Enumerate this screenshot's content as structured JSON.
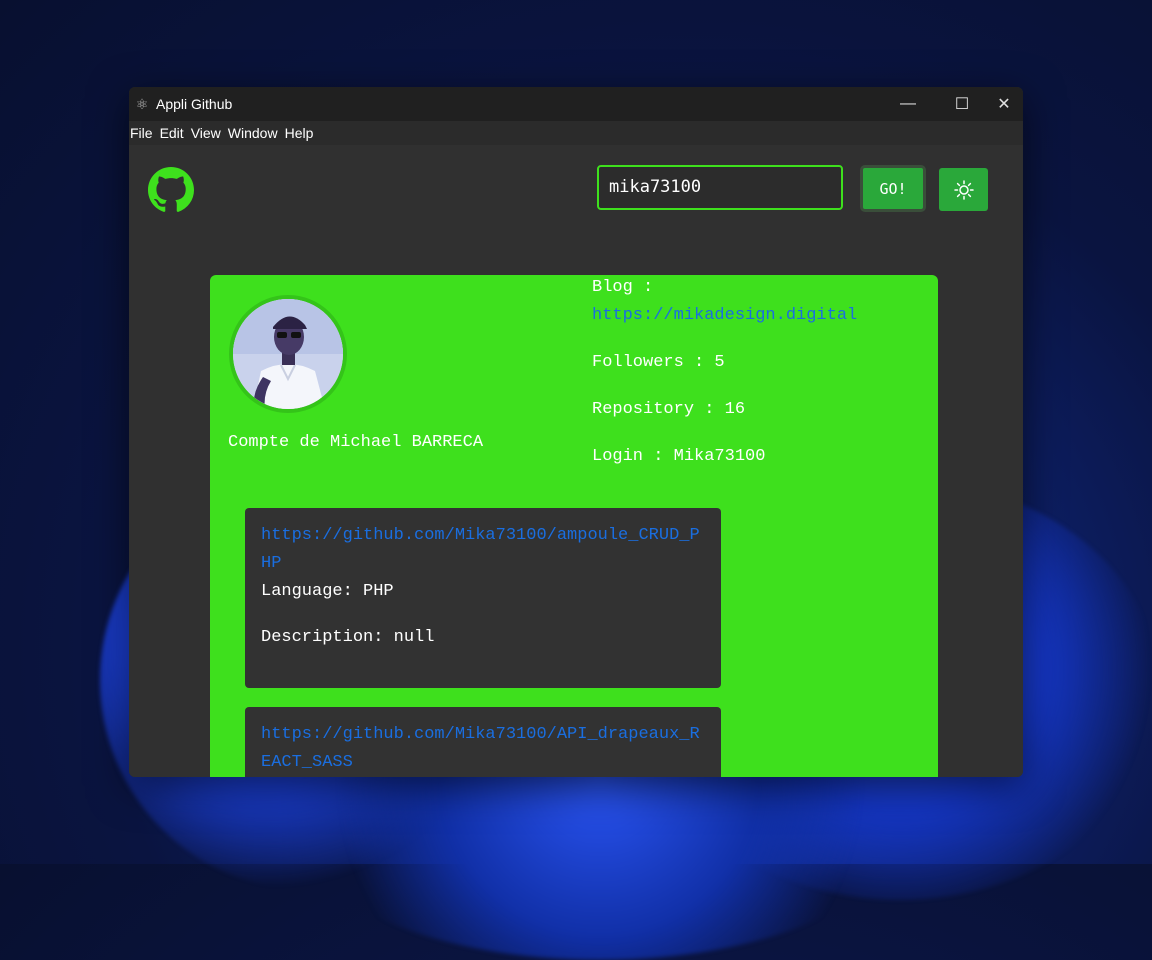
{
  "window": {
    "title": "Appli Github",
    "controls": {
      "minimize": "—",
      "maximize": "☐",
      "close": "✕"
    }
  },
  "menu": [
    "File",
    "Edit",
    "View",
    "Window",
    "Help"
  ],
  "header": {
    "logo_icon": "github-icon",
    "search_value": "mika73100",
    "go_label": "GO!",
    "theme_icon": "sun-icon"
  },
  "profile": {
    "account_name": "Compte de Michael BARRECA",
    "blog_label": "Blog :",
    "blog_url": "https://mikadesign.digital",
    "followers": "Followers : 5",
    "repository": "Repository : 16",
    "login": "Login : Mika73100"
  },
  "repos": [
    {
      "url": "https://github.com/Mika73100/ampoule_CRUD_PHP",
      "language": "Language: PHP",
      "description": "Description: null"
    },
    {
      "url": "https://github.com/Mika73100/API_drapeaux_REACT_SASS"
    }
  ],
  "colors": {
    "accent_green": "#3ee01d",
    "button_green": "#2aa83a",
    "link_blue": "#1a6ee0",
    "background": "#303030"
  }
}
